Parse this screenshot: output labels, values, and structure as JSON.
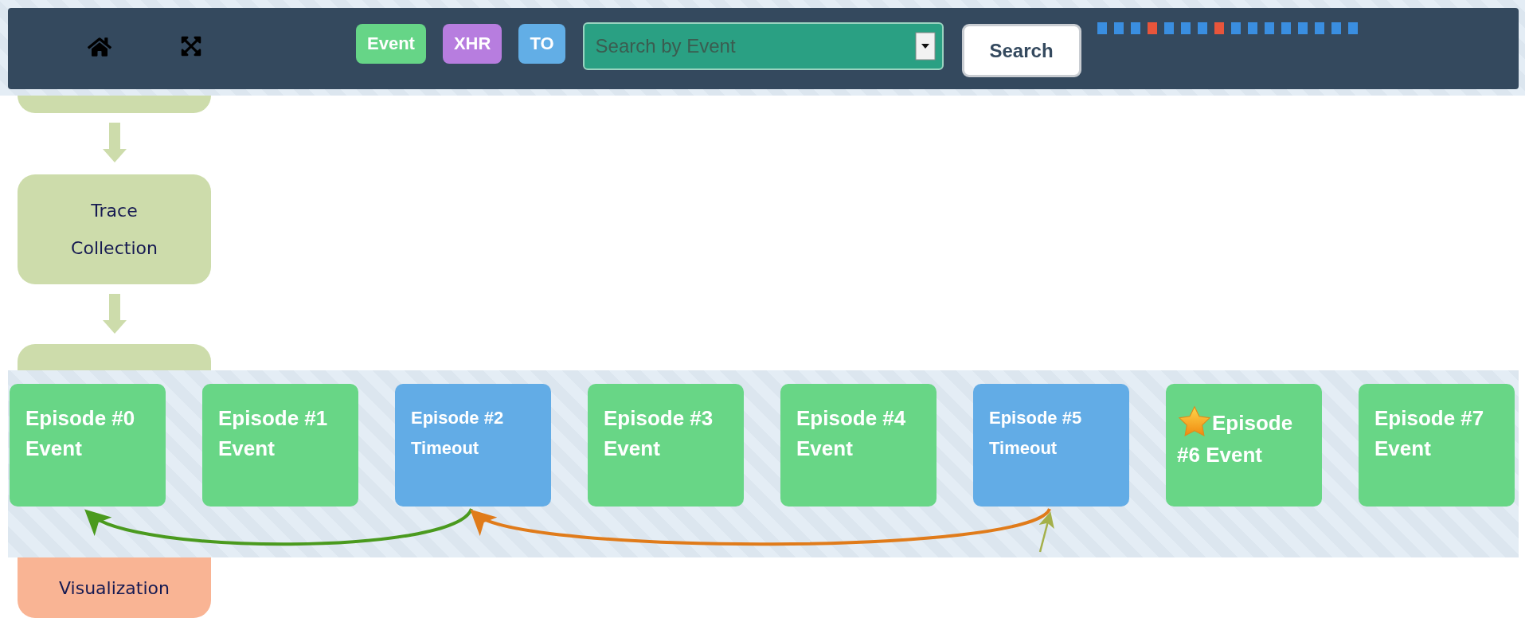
{
  "toolbar": {
    "legend": [
      {
        "label": "Event",
        "color": "#66d587"
      },
      {
        "label": "XHR",
        "color": "#b77ddf"
      },
      {
        "label": "TO",
        "color": "#62aee6"
      }
    ],
    "search": {
      "placeholder": "Search by Event"
    },
    "search_button": "Search",
    "timeline": [
      {
        "color": "#3a8ee0"
      },
      {
        "color": "#3a8ee0"
      },
      {
        "color": "#3a8ee0"
      },
      {
        "color": "#e8553b"
      },
      {
        "color": "#3a8ee0"
      },
      {
        "color": "#3a8ee0"
      },
      {
        "color": "#3a8ee0"
      },
      {
        "color": "#e8553b"
      },
      {
        "color": "#3a8ee0"
      },
      {
        "color": "#3a8ee0"
      },
      {
        "color": "#3a8ee0"
      },
      {
        "color": "#3a8ee0"
      },
      {
        "color": "#3a8ee0"
      },
      {
        "color": "#3a8ee0"
      },
      {
        "color": "#3a8ee0"
      },
      {
        "color": "#3a8ee0"
      }
    ]
  },
  "pipeline": {
    "step": "Trace Collection",
    "output_step": "Visualization"
  },
  "episodes": [
    {
      "title": "Episode #0",
      "type": "Event",
      "kind": "event",
      "starred": false
    },
    {
      "title": "Episode #1",
      "type": "Event",
      "kind": "event",
      "starred": false
    },
    {
      "title": "Episode #2",
      "type": "Timeout",
      "kind": "timeout",
      "starred": false
    },
    {
      "title": "Episode #3",
      "type": "Event",
      "kind": "event",
      "starred": false
    },
    {
      "title": "Episode #4",
      "type": "Event",
      "kind": "event",
      "starred": false
    },
    {
      "title": "Episode #5",
      "type": "Timeout",
      "kind": "timeout",
      "starred": false
    },
    {
      "title": "Episode #6",
      "type": "Event",
      "kind": "event",
      "starred": true
    },
    {
      "title": "Episode #7",
      "type": "Event",
      "kind": "event",
      "starred": false
    }
  ],
  "links": [
    {
      "kind": "arc",
      "color": "#4a9a1e"
    },
    {
      "kind": "arc",
      "color": "#e07b1a"
    },
    {
      "kind": "stub",
      "color": "#a4b04a"
    }
  ]
}
